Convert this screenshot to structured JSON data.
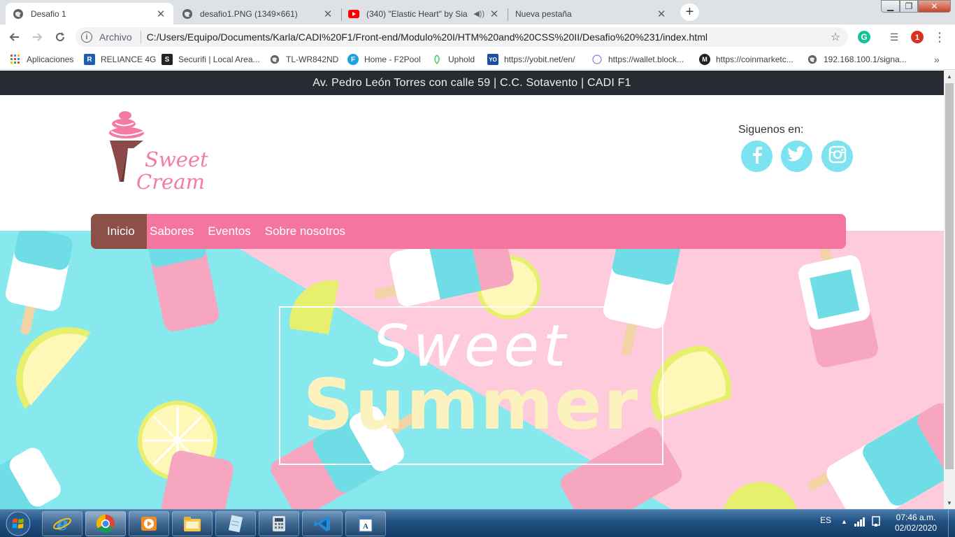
{
  "browser": {
    "tabs": [
      {
        "title": "Desafio 1",
        "favicon": "globe-icon"
      },
      {
        "title": "desafio1.PNG (1349×661)",
        "favicon": "globe-icon"
      },
      {
        "title": "(340) \"Elastic Heart\" by Sia - ",
        "favicon": "youtube-icon"
      },
      {
        "title": "Nueva pestaña",
        "favicon": "none"
      }
    ],
    "new_tab_label": "+",
    "address": {
      "scheme_label": "Archivo",
      "url": "C:/Users/Equipo/Documents/Karla/CADI%20F1/Front-end/Modulo%20I/HTM%20and%20CSS%20II/Desafio%20%231/index.html"
    },
    "bookmarks": [
      {
        "label": "Aplicaciones",
        "icon": "apps-grid-icon"
      },
      {
        "label": "RELIANCE 4G",
        "icon": "reliance-icon",
        "badge": "R"
      },
      {
        "label": "Securifi | Local Area...",
        "icon": "securifi-icon",
        "badge": "S"
      },
      {
        "label": "TL-WR842ND",
        "icon": "globe-icon"
      },
      {
        "label": "Home - F2Pool",
        "icon": "f2pool-icon",
        "badge": "F"
      },
      {
        "label": "Uphold",
        "icon": "uphold-icon"
      },
      {
        "label": "https://yobit.net/en/",
        "icon": "yobit-icon",
        "badge": "YO"
      },
      {
        "label": "https://wallet.block...",
        "icon": "blockchain-icon"
      },
      {
        "label": "https://coinmarketc...",
        "icon": "coinmarketcap-icon",
        "badge": "M"
      },
      {
        "label": "192.168.100.1/signa...",
        "icon": "globe-icon"
      }
    ],
    "bookmarks_more": "»"
  },
  "page": {
    "top_bar_text": "Av. Pedro León Torres con calle 59 | C.C. Sotavento | CADI F1",
    "logo": {
      "line1": "Sweet",
      "line2": "Cream"
    },
    "social": {
      "label": "Siguenos en:",
      "links": [
        "facebook-icon",
        "twitter-icon",
        "instagram-icon"
      ]
    },
    "nav": [
      "Inicio",
      "Sabores",
      "Eventos",
      "Sobre nosotros"
    ],
    "hero": {
      "line1": "Sweet",
      "line2": "Summer"
    },
    "colors": {
      "topbar": "#262c31",
      "nav_pink": "#f476a0",
      "nav_active": "#8c5049",
      "social_circle": "#7de3f1",
      "hero_blue": "#87e8ee",
      "hero_pink": "#fdcbdc",
      "hero_summer_text": "#fcf2bd"
    }
  },
  "taskbar": {
    "apps": [
      "internet-explorer-icon",
      "chrome-icon",
      "media-player-icon",
      "file-explorer-icon",
      "notepad-icon",
      "calculator-icon",
      "vscode-icon",
      "wordpad-icon"
    ],
    "language": "ES",
    "time": "07:46 a.m.",
    "date": "02/02/2020"
  }
}
